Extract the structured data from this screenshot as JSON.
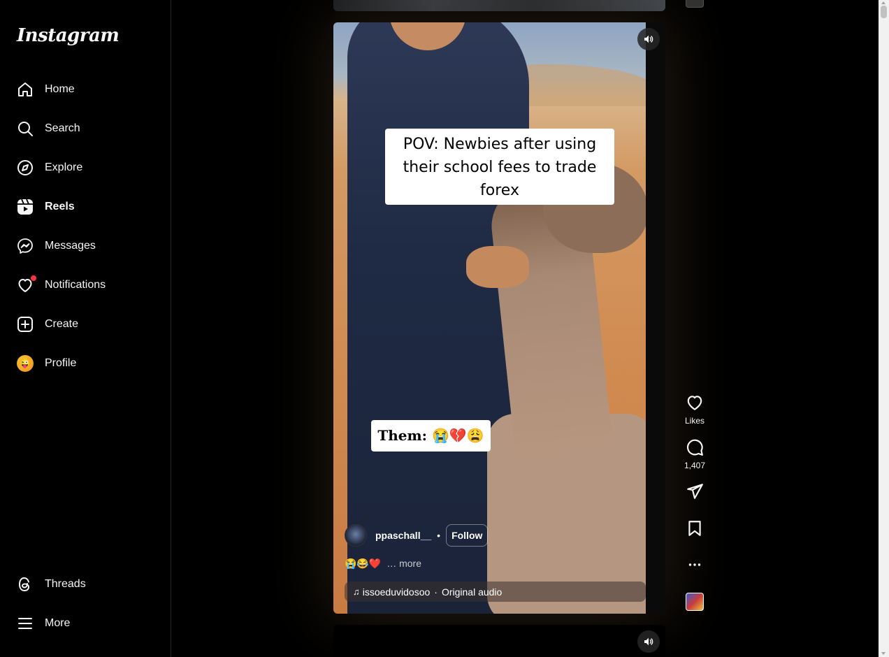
{
  "app": {
    "logo_text": "Instagram"
  },
  "sidebar": {
    "items": [
      {
        "label": "Home",
        "icon": "home-icon"
      },
      {
        "label": "Search",
        "icon": "search-icon"
      },
      {
        "label": "Explore",
        "icon": "compass-icon"
      },
      {
        "label": "Reels",
        "icon": "reels-icon",
        "active": true
      },
      {
        "label": "Messages",
        "icon": "messenger-icon"
      },
      {
        "label": "Notifications",
        "icon": "heart-icon",
        "has_badge": true
      },
      {
        "label": "Create",
        "icon": "plus-square-icon"
      },
      {
        "label": "Profile",
        "icon": "avatar"
      }
    ],
    "bottom_items": [
      {
        "label": "Threads",
        "icon": "threads-icon"
      },
      {
        "label": "More",
        "icon": "menu-icon"
      }
    ]
  },
  "reel": {
    "caption_overlay_1": "POV: Newbies after using their school fees to trade forex",
    "caption_overlay_2": "Them: 😭💔😩",
    "author": {
      "username": "ppaschall__",
      "separator": "•",
      "follow_label": "Follow"
    },
    "description": "😭😂❤️",
    "more_label": "… more",
    "audio": {
      "artist": "issoeduvidosoo",
      "separator": "·",
      "title": "Original audio"
    }
  },
  "actions": {
    "likes_label": "Likes",
    "comments_count": "1,407"
  },
  "colors": {
    "background": "#000000",
    "notification_badge": "#ff3040",
    "text": "#f5f5f5"
  }
}
